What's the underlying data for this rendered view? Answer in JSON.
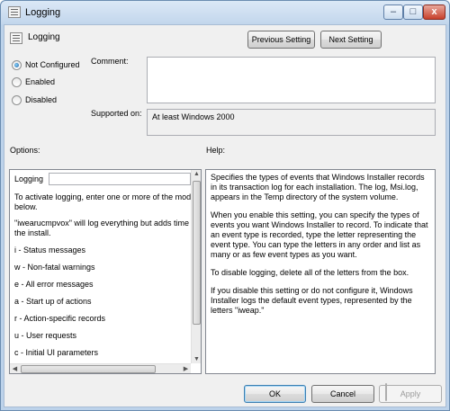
{
  "window": {
    "title": "Logging",
    "controls": {
      "minimize": "–",
      "maximize": "□",
      "close": "x"
    }
  },
  "header": {
    "setting_name": "Logging",
    "previous_label": "Previous Setting",
    "next_label": "Next Setting"
  },
  "state": {
    "options": [
      "Not Configured",
      "Enabled",
      "Disabled"
    ],
    "selected": "Not Configured"
  },
  "comment": {
    "label": "Comment:",
    "value": ""
  },
  "supported": {
    "label": "Supported on:",
    "value": "At least Windows 2000"
  },
  "options_pane": {
    "label": "Options:",
    "field_label": "Logging",
    "field_value": "",
    "lines": [
      "To activate logging, enter one or more of the modes",
      "below.",
      "\"iwearucmpvox\" will log everything but adds time to",
      "the install.",
      "i - Status messages",
      "w - Non-fatal warnings",
      "e - All error messages",
      "a - Start up of actions",
      "r - Action-specific records",
      "u - User requests",
      "c - Initial UI parameters"
    ]
  },
  "help_pane": {
    "label": "Help:",
    "paragraphs": [
      "Specifies the types of events that Windows Installer records in its transaction log for each installation. The log, Msi.log, appears in the Temp directory of the system volume.",
      "When you enable this setting, you can specify the types of events you want Windows Installer to record. To indicate that an event type is recorded, type the letter representing the event type. You can type the letters in any order and list as many or as few event types as you want.",
      "To disable logging, delete all of the letters from the box.",
      "If you disable this setting or do not configure it, Windows Installer logs the default event types, represented by the letters \"iweap.\""
    ]
  },
  "footer": {
    "ok": "OK",
    "cancel": "Cancel",
    "apply": "Apply"
  }
}
